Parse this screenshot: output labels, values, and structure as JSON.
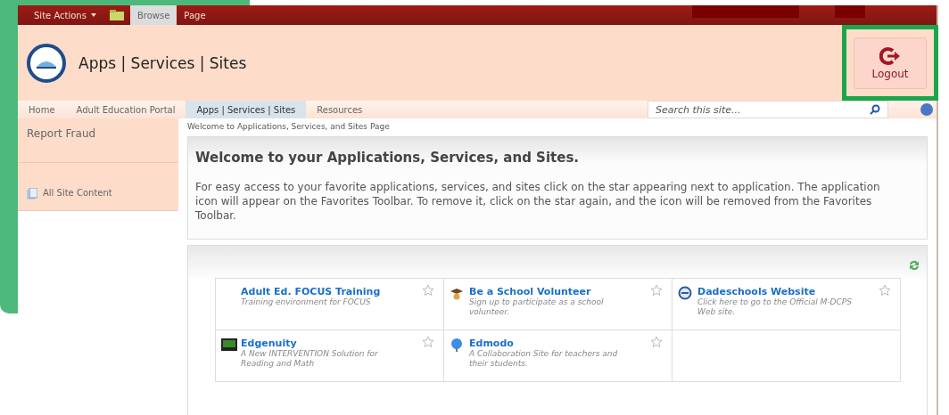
{
  "ribbon": {
    "site_actions": "Site Actions",
    "tabs": [
      {
        "label": "Browse",
        "selected": true
      },
      {
        "label": "Page",
        "selected": false
      }
    ]
  },
  "header": {
    "title": "Apps | Services | Sites",
    "logout": "Logout"
  },
  "nav": {
    "items": [
      {
        "label": "Home",
        "selected": false
      },
      {
        "label": "Adult Education Portal",
        "selected": false
      },
      {
        "label": "Apps | Services | Sites",
        "selected": true
      },
      {
        "label": "Resources",
        "selected": false
      }
    ],
    "search": {
      "placeholder": "Search this site..."
    }
  },
  "sidebar": {
    "items": [
      {
        "label": "Report Fraud",
        "kind": "link"
      },
      {
        "label": "All Site Content",
        "kind": "content"
      }
    ]
  },
  "breadcrumb": "Welcome to Applications, Services, and Sites Page",
  "welcome": {
    "title": "Welcome to your Applications, Services, and Sites.",
    "body": "For easy access to your favorite applications, services, and sites click on the star appearing next to application. The application icon will appear on the Favorites Toolbar.  To remove it, click on the star again, and the icon will be removed from the Favorites Toolbar."
  },
  "apps": [
    {
      "name": "Adult Ed. FOCUS Training",
      "description": "Training environment for FOCUS",
      "kind": "plain",
      "favorite": false
    },
    {
      "name": "Be a School Volunteer",
      "description": "Sign up to participate as a school volunteer.",
      "kind": "volunteer",
      "favorite": false
    },
    {
      "name": "Dadeschools Website",
      "description": "Click here to go to the Official M-DCPS Web site.",
      "kind": "website",
      "favorite": false
    },
    {
      "name": "Edgenuity",
      "description": "A New INTERVENTION Solution for Reading and Math",
      "kind": "course",
      "favorite": false
    },
    {
      "name": "Edmodo",
      "description": "A Collaboration Site for teachers and their students.",
      "kind": "community",
      "favorite": false
    }
  ]
}
